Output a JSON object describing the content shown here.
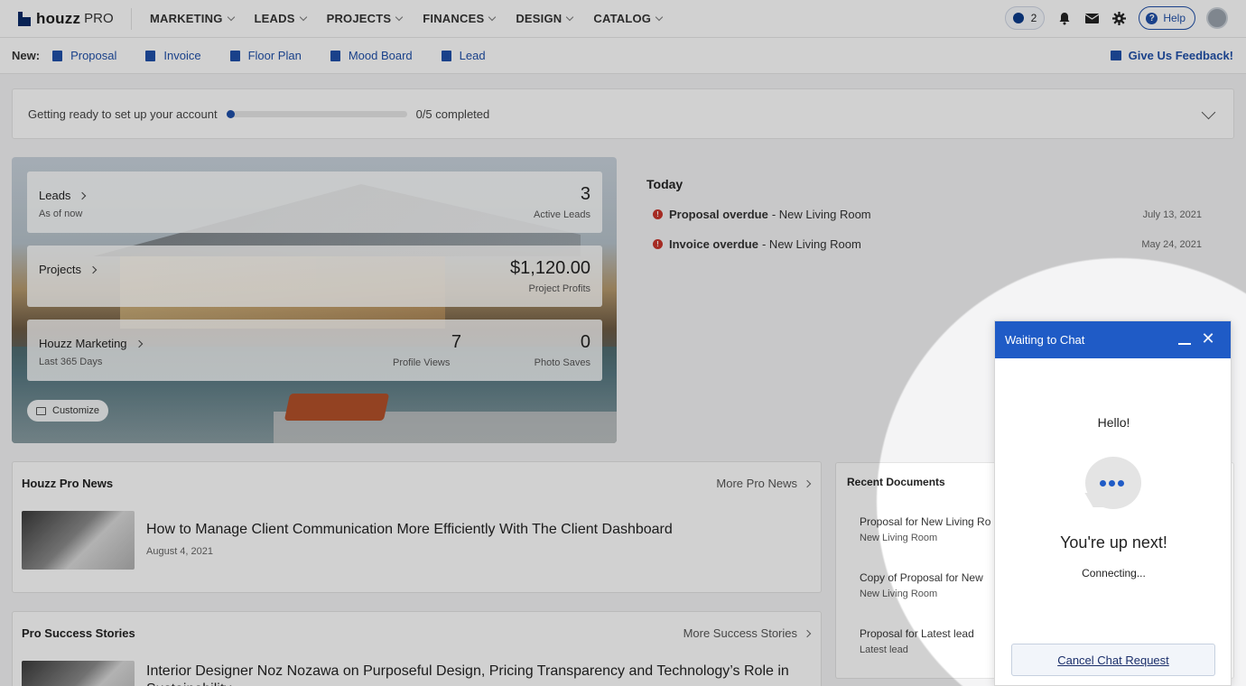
{
  "topnav": {
    "logo": "houzz",
    "logo_suffix": "PRO",
    "menu": [
      "MARKETING",
      "LEADS",
      "PROJECTS",
      "FINANCES",
      "DESIGN",
      "CATALOG"
    ],
    "timer_count": "2",
    "help_label": "Help"
  },
  "newbar": {
    "label": "New:",
    "items": [
      "Proposal",
      "Invoice",
      "Floor Plan",
      "Mood Board",
      "Lead"
    ],
    "feedback": "Give Us Feedback!"
  },
  "setup": {
    "label": "Getting ready to set up your account",
    "completed": "0/5 completed",
    "progress_fraction": 0.0
  },
  "hero": {
    "leads": {
      "title": "Leads",
      "sub": "As of now",
      "value": "3",
      "value_label": "Active Leads"
    },
    "projects": {
      "title": "Projects",
      "value": "$1,120.00",
      "value_label": "Project Profits"
    },
    "marketing": {
      "title": "Houzz Marketing",
      "sub": "Last 365 Days",
      "views": "7",
      "views_label": "Profile Views",
      "saves": "0",
      "saves_label": "Photo Saves"
    },
    "customize": "Customize"
  },
  "today": {
    "title": "Today",
    "items": [
      {
        "strong": "Proposal overdue",
        "rest": "- New Living Room",
        "date": "July 13, 2021"
      },
      {
        "strong": "Invoice overdue",
        "rest": "- New Living Room",
        "date": "May 24, 2021"
      }
    ]
  },
  "news": {
    "title": "Houzz Pro News",
    "more": "More Pro News",
    "headline": "How to Manage Client Communication More Efficiently With The Client Dashboard",
    "date": "August 4, 2021"
  },
  "stories": {
    "title": "Pro Success Stories",
    "more": "More Success Stories",
    "headline": "Interior Designer Noz Nozawa on Purposeful Design, Pricing Transparency and Technology’s Role in Sustainability"
  },
  "recent": {
    "title": "Recent Documents",
    "docs": [
      {
        "name": "Proposal for New Living Ro",
        "sub": "New Living Room"
      },
      {
        "name": "Copy of Proposal for New",
        "sub": "New Living Room"
      },
      {
        "name": "Proposal for Latest lead",
        "sub": "Latest lead"
      }
    ]
  },
  "chat": {
    "title": "Waiting to Chat",
    "hello": "Hello!",
    "next": "You're up next!",
    "connecting": "Connecting...",
    "cancel": "Cancel Chat Request"
  }
}
